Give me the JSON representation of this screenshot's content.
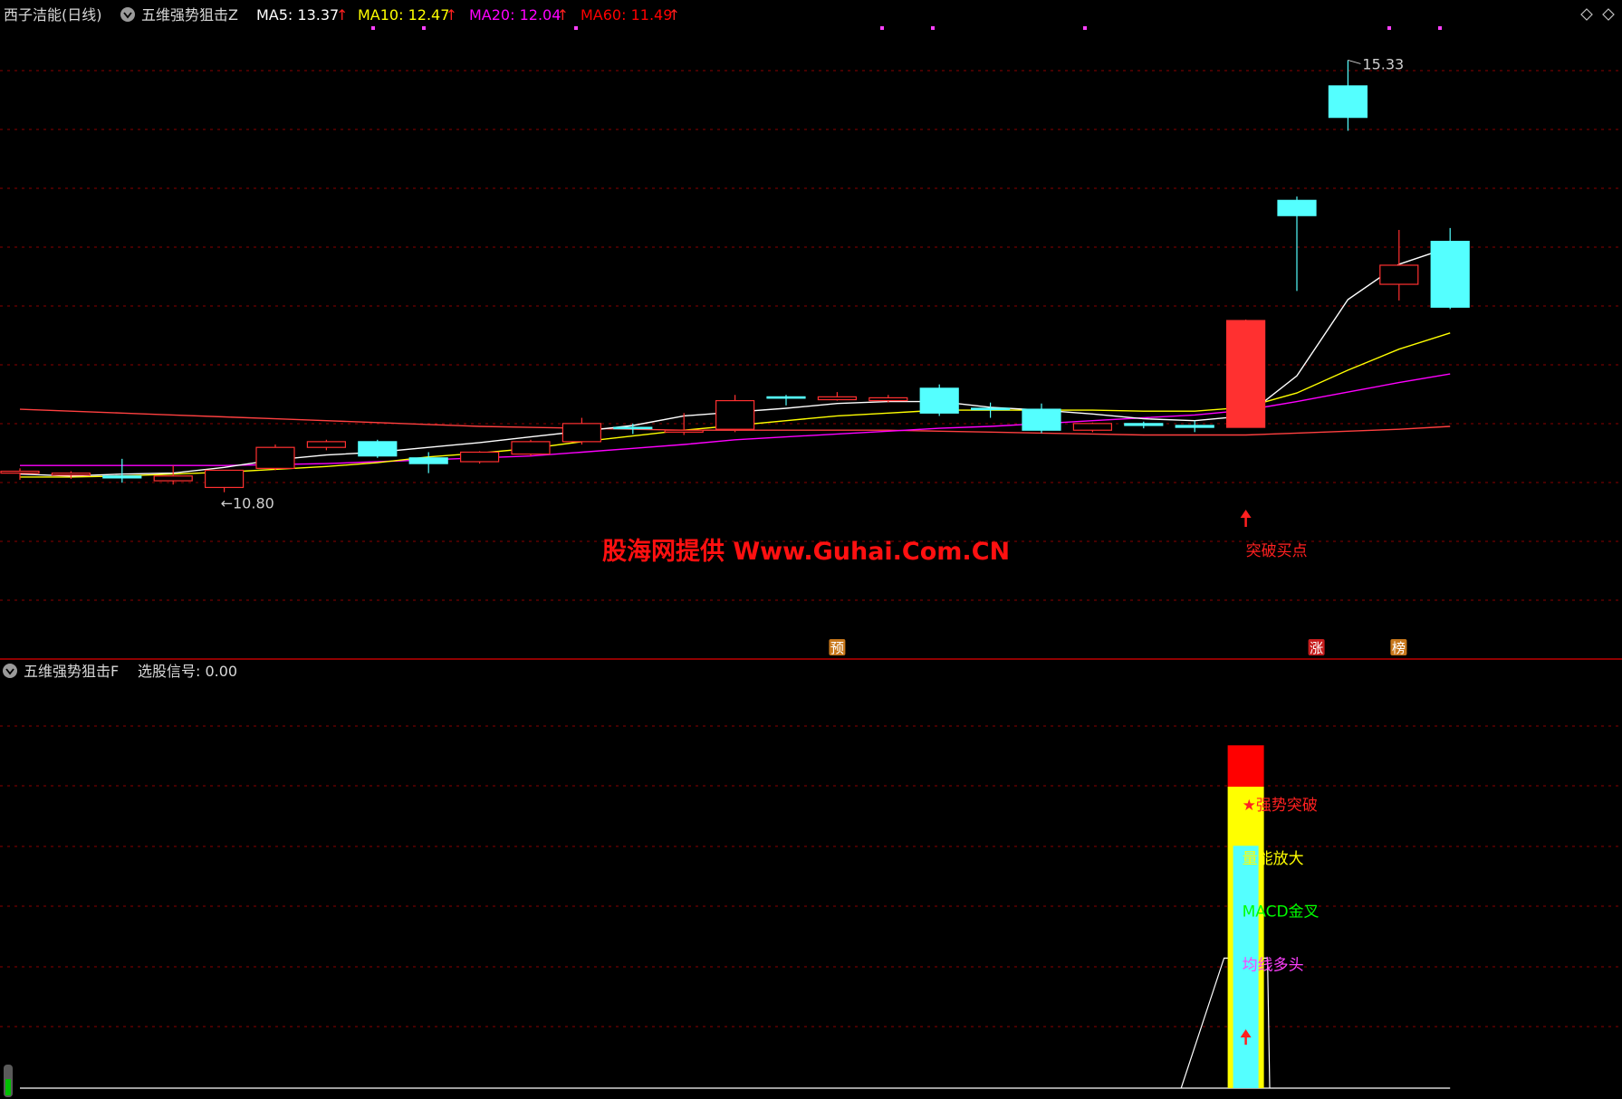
{
  "header": {
    "stock_name": "西子洁能(日线)",
    "indicator_name": "五维强势狙击Z",
    "ma": [
      {
        "label": "MA5: 13.37",
        "color": "#ffffff"
      },
      {
        "label": "MA10: 12.47",
        "color": "#ffff00"
      },
      {
        "label": "MA20: 12.04",
        "color": "#ff00ff"
      },
      {
        "label": "MA60: 11.49",
        "color": "#ff0000"
      }
    ],
    "arrow_glyph": "↑"
  },
  "lower_header": {
    "indicator_name": "五维强势狙击F",
    "signal_label": "选股信号: 0.00"
  },
  "watermark": "股海网提供 Www.Guhai.Com.CN",
  "colors": {
    "up": "#ff3030",
    "down": "#54ffff",
    "ma5": "#ffffff",
    "ma10": "#ffff00",
    "ma20": "#ff00ff",
    "ma60": "#ff4040",
    "grid": "#8b0000",
    "watermark": "#ff1010"
  },
  "chart_data": [
    {
      "type": "candlestick",
      "title": "西子洁能(日线)",
      "ylim": [
        10.0,
        15.6
      ],
      "candles": [
        {
          "o": 11.0,
          "h": 11.05,
          "l": 10.93,
          "c": 11.02
        },
        {
          "o": 10.98,
          "h": 11.02,
          "l": 10.94,
          "c": 11.0
        },
        {
          "o": 10.97,
          "h": 11.15,
          "l": 10.9,
          "c": 10.95
        },
        {
          "o": 10.92,
          "h": 11.08,
          "l": 10.88,
          "c": 10.97
        },
        {
          "o": 10.85,
          "h": 11.02,
          "l": 10.8,
          "c": 11.03
        },
        {
          "o": 11.05,
          "h": 11.3,
          "l": 11.03,
          "c": 11.27
        },
        {
          "o": 11.27,
          "h": 11.35,
          "l": 11.24,
          "c": 11.33
        },
        {
          "o": 11.33,
          "h": 11.35,
          "l": 11.16,
          "c": 11.18
        },
        {
          "o": 11.16,
          "h": 11.22,
          "l": 11.0,
          "c": 11.1
        },
        {
          "o": 11.12,
          "h": 11.23,
          "l": 11.1,
          "c": 11.22
        },
        {
          "o": 11.2,
          "h": 11.35,
          "l": 11.18,
          "c": 11.33
        },
        {
          "o": 11.33,
          "h": 11.58,
          "l": 11.3,
          "c": 11.52
        },
        {
          "o": 11.48,
          "h": 11.52,
          "l": 11.41,
          "c": 11.47
        },
        {
          "o": 11.43,
          "h": 11.63,
          "l": 11.4,
          "c": 11.45
        },
        {
          "o": 11.46,
          "h": 11.82,
          "l": 11.43,
          "c": 11.76
        },
        {
          "o": 11.8,
          "h": 11.82,
          "l": 11.71,
          "c": 11.79
        },
        {
          "o": 11.77,
          "h": 11.85,
          "l": 11.76,
          "c": 11.8
        },
        {
          "o": 11.76,
          "h": 11.82,
          "l": 11.74,
          "c": 11.79
        },
        {
          "o": 11.89,
          "h": 11.93,
          "l": 11.6,
          "c": 11.63
        },
        {
          "o": 11.68,
          "h": 11.74,
          "l": 11.58,
          "c": 11.67
        },
        {
          "o": 11.67,
          "h": 11.73,
          "l": 11.42,
          "c": 11.45
        },
        {
          "o": 11.45,
          "h": 11.53,
          "l": 11.43,
          "c": 11.52
        },
        {
          "o": 11.52,
          "h": 11.54,
          "l": 11.47,
          "c": 11.5
        },
        {
          "o": 11.5,
          "h": 11.55,
          "l": 11.43,
          "c": 11.48
        },
        {
          "o": 11.48,
          "h": 12.61,
          "l": 11.48,
          "c": 12.6
        },
        {
          "o": 13.86,
          "h": 13.9,
          "l": 12.91,
          "c": 13.7
        },
        {
          "o": 15.06,
          "h": 15.33,
          "l": 14.59,
          "c": 14.73
        },
        {
          "o": 12.98,
          "h": 13.55,
          "l": 12.81,
          "c": 13.18
        },
        {
          "o": 13.43,
          "h": 13.57,
          "l": 12.72,
          "c": 12.74
        }
      ],
      "ma5": [
        10.99,
        10.97,
        10.99,
        11.0,
        11.06,
        11.14,
        11.19,
        11.22,
        11.27,
        11.32,
        11.38,
        11.44,
        11.5,
        11.6,
        11.64,
        11.68,
        11.73,
        11.75,
        11.75,
        11.69,
        11.66,
        11.62,
        11.57,
        11.55,
        11.6,
        12.02,
        12.82,
        13.19,
        13.37
      ],
      "ma10": [
        10.96,
        10.96,
        10.97,
        10.99,
        11.01,
        11.04,
        11.07,
        11.11,
        11.17,
        11.21,
        11.26,
        11.33,
        11.39,
        11.45,
        11.5,
        11.55,
        11.6,
        11.63,
        11.66,
        11.66,
        11.66,
        11.66,
        11.65,
        11.65,
        11.69,
        11.84,
        12.08,
        12.3,
        12.47
      ],
      "ma20": [
        11.08,
        11.08,
        11.08,
        11.08,
        11.08,
        11.09,
        11.1,
        11.12,
        11.14,
        11.16,
        11.18,
        11.22,
        11.26,
        11.3,
        11.35,
        11.38,
        11.41,
        11.44,
        11.47,
        11.49,
        11.52,
        11.55,
        11.58,
        11.61,
        11.66,
        11.75,
        11.85,
        11.95,
        12.04
      ],
      "ma60": [
        11.67,
        11.65,
        11.63,
        11.61,
        11.59,
        11.57,
        11.55,
        11.53,
        11.51,
        11.49,
        11.48,
        11.47,
        11.46,
        11.45,
        11.45,
        11.45,
        11.45,
        11.45,
        11.44,
        11.43,
        11.42,
        11.41,
        11.4,
        11.4,
        11.4,
        11.42,
        11.44,
        11.46,
        11.49
      ],
      "annotations": {
        "high_label": "15.33",
        "low_label": "10.80",
        "buy_point": "突破买点",
        "badges": [
          "预",
          "涨",
          "榜"
        ]
      }
    },
    {
      "type": "bar",
      "title": "五维强势狙击F",
      "ylim": [
        0,
        6.8
      ],
      "signal_index": 24,
      "stack": [
        {
          "name": "均线多头",
          "value": 2.1,
          "color": "#54ffff",
          "label_color": "#ff40ff"
        },
        {
          "name": "MACD金叉",
          "value": 1.0,
          "color": "#54ffff",
          "label_color": "#00ff00"
        },
        {
          "name": "量能放大",
          "value": 1.0,
          "color": "#54ffff",
          "label_color": "#ffff00"
        },
        {
          "name": "★强势突破",
          "value": 1.0,
          "color": "#ffff00",
          "label_color": "#ff2020"
        },
        {
          "name": "顶部",
          "value": 0.7,
          "color": "#ff0000",
          "label_color": "#ff0000"
        }
      ],
      "labels": [
        "★强势突破",
        "量能放大",
        "MACD金叉",
        "均线多头"
      ],
      "line_peak": 2.2
    }
  ]
}
